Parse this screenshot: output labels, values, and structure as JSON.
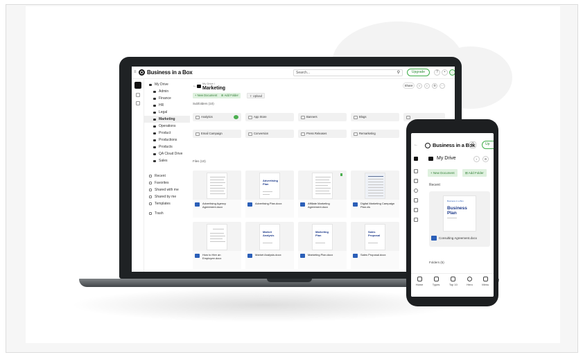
{
  "laptop": {
    "brand": "Business in a Box",
    "search_placeholder": "Search...",
    "upgrade_label": "Upgrade",
    "sidebar": {
      "root": "My Drive",
      "folders": [
        "Admin",
        "Finance",
        "HR",
        "Legal",
        "Marketing",
        "Operations",
        "Product",
        "Productions",
        "Products",
        "QA Cloud Drive",
        "Sales"
      ],
      "active": "Marketing",
      "links": [
        "Recent",
        "Favorites",
        "Shared with me",
        "Shared by me",
        "Templates",
        "Trash"
      ]
    },
    "main": {
      "breadcrumb": "My Drive /",
      "title": "Marketing",
      "share_label": "Share",
      "new_document": "+ New Document",
      "add_folder": "Add Folder",
      "upload": "Upload",
      "subfolders_heading": "Subfolders (10)",
      "subfolders": [
        "Analytics",
        "App Store",
        "Banners",
        "Blogs",
        "Email Campaign",
        "Conversion",
        "Press Releases",
        "Remarketing"
      ],
      "files_heading": "Files (10)",
      "files": [
        {
          "name": "Advertising Agency Agreement.docx",
          "page_title": ""
        },
        {
          "name": "Advertising Plan.docx",
          "page_title": "Advertising Plan"
        },
        {
          "name": "Affiliate Marketing Agreement.docx",
          "page_title": ""
        },
        {
          "name": "Digital Marketing Campaign Plan.xls",
          "page_title": ""
        },
        {
          "name": "How to Hire an Employee.docx",
          "page_title": ""
        },
        {
          "name": "Market Analysis.docx",
          "page_title": "Market Analysis"
        },
        {
          "name": "Marketing Plan.docx",
          "page_title": "Marketing Plan"
        },
        {
          "name": "Sales Proposal.docx",
          "page_title": "Sales Proposal"
        }
      ]
    }
  },
  "phone": {
    "brand": "Business in a Box",
    "upgrade_label": "Up",
    "title": "My Drive",
    "new_document": "+ New Document",
    "add_folder": "Add Folder",
    "recent_heading": "Recent",
    "recent_doc": {
      "page_title": "Business Plan",
      "page_logo": "Business in a Box",
      "file_name": "Consulting Agreement.docx"
    },
    "folders_heading": "Folders (5)",
    "nav": [
      "Home",
      "Types",
      "Top 10",
      "Hero",
      "Menu"
    ]
  },
  "colors": {
    "accent_green": "#3fae49",
    "doc_blue": "#1d3a8a",
    "laptop_frame": "#1f2224"
  }
}
